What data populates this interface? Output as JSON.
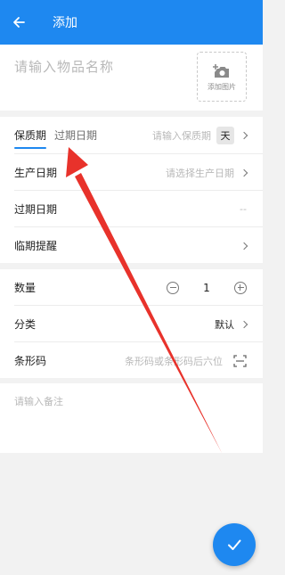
{
  "appbar": {
    "title": "添加"
  },
  "item": {
    "name_placeholder": "请输入物品名称",
    "photo_label": "添加图片"
  },
  "dates": {
    "tab_shelf_life": "保质期",
    "tab_expiry": "过期日期",
    "shelf_life_placeholder": "请输入保质期",
    "unit": "天",
    "production_label": "生产日期",
    "production_placeholder": "请选择生产日期",
    "expiry_label": "过期日期",
    "expiry_value": "--",
    "reminder_label": "临期提醒"
  },
  "misc": {
    "quantity_label": "数量",
    "quantity_value": "1",
    "category_label": "分类",
    "category_value": "默认",
    "barcode_label": "条形码",
    "barcode_placeholder": "条形码或条形码后六位"
  },
  "note": {
    "placeholder": "请输入备注"
  },
  "colors": {
    "primary": "#1e88f0",
    "annotation_arrow": "#e8322b"
  },
  "icons": {
    "back": "arrow-left-icon",
    "photo": "camera-plus-icon",
    "chevron": "chevron-right-icon",
    "minus": "minus-circle-icon",
    "plus": "plus-circle-icon",
    "scan": "scan-icon",
    "confirm": "check-icon"
  }
}
